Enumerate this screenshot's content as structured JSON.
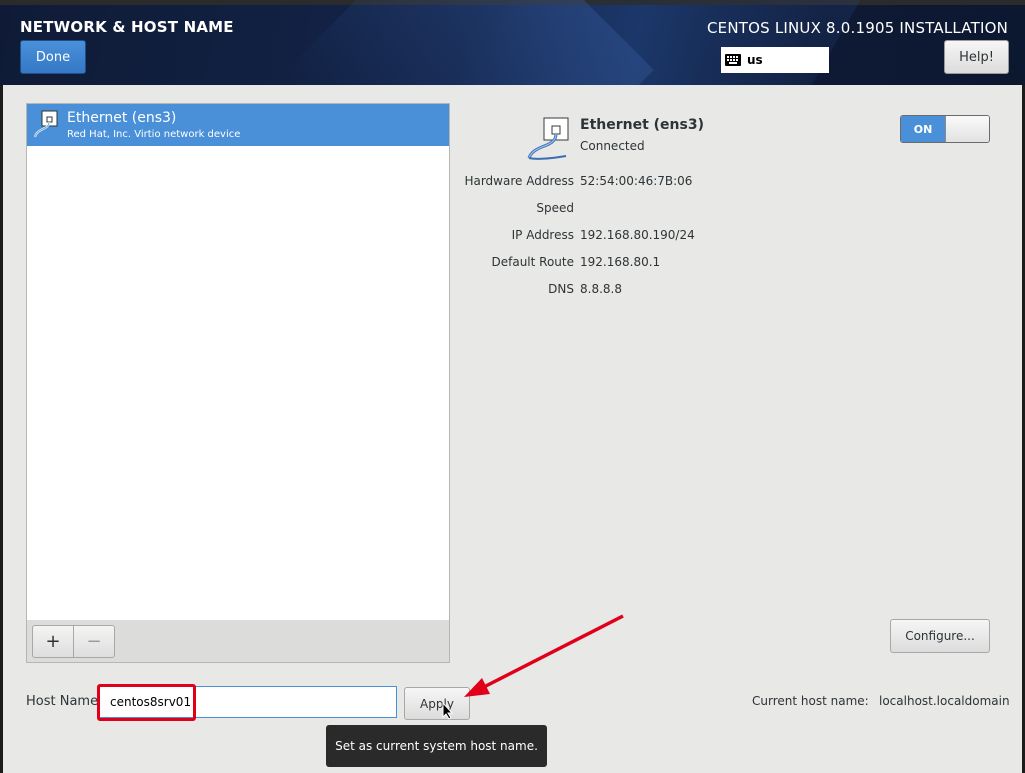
{
  "header": {
    "spoke_title": "NETWORK & HOST NAME",
    "done_label": "Done",
    "product_title": "CENTOS LINUX 8.0.1905 INSTALLATION",
    "keyboard_layout": "us",
    "help_label": "Help!"
  },
  "device_list": {
    "items": [
      {
        "name": "Ethernet (ens3)",
        "description": "Red Hat, Inc. Virtio network device",
        "selected": true
      }
    ],
    "add_label": "+",
    "remove_label": "−"
  },
  "device_detail": {
    "name": "Ethernet (ens3)",
    "status": "Connected",
    "toggle_label": "ON",
    "toggle_state": "on",
    "properties": [
      {
        "label": "Hardware Address",
        "value": "52:54:00:46:7B:06"
      },
      {
        "label": "Speed",
        "value": ""
      },
      {
        "label": "IP Address",
        "value": "192.168.80.190/24"
      },
      {
        "label": "Default Route",
        "value": "192.168.80.1"
      },
      {
        "label": "DNS",
        "value": "8.8.8.8"
      }
    ],
    "configure_label": "Configure..."
  },
  "hostname": {
    "label": "Host Name:",
    "value": "centos8srv01",
    "apply_label": "Apply",
    "current_label": "Current host name:",
    "current_value": "localhost.localdomain",
    "tooltip": "Set as current system host name."
  },
  "colors": {
    "accent": "#4a90d9",
    "annotation": "#e0001a",
    "header_bg": "#13244a"
  }
}
